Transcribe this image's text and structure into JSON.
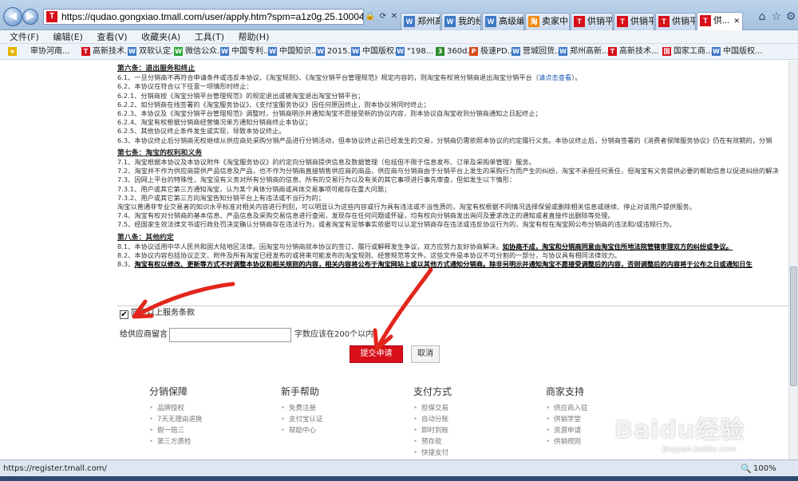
{
  "browser": {
    "url": "https://qudao.gongxiao.tmall.com/user/apply.htm?spm=a1z0g.25.1000440.6.53zmjz&suppli",
    "tabs": [
      {
        "label": "郑州高..."
      },
      {
        "label": "我的经..."
      },
      {
        "label": "高级编..."
      },
      {
        "label": "卖家中..."
      },
      {
        "label": "供销平台"
      },
      {
        "label": "供销平台"
      },
      {
        "label": "供销平台"
      },
      {
        "label": "供..."
      }
    ],
    "menu": [
      "文件(F)",
      "编辑(E)",
      "查看(V)",
      "收藏夹(A)",
      "工具(T)",
      "帮助(H)"
    ],
    "favorites": [
      "审协河南...",
      "高新技术...",
      "双软认定...",
      "微信公众...",
      "中国专利...",
      "中国知识...",
      "2015...",
      "中国版权...",
      "\"198...",
      "360d...",
      "极速PD...",
      "营城回货...",
      "郑州高新...",
      "高新技术...",
      "国家工商...",
      "中国版权..."
    ],
    "status_url": "https://register.tmall.com/",
    "zoom": "100%"
  },
  "agreement": {
    "lines": [
      {
        "text": "第六条：退出服务和终止",
        "style": "h"
      },
      {
        "text": "6.1、一旦分销商不再符合申请条件或违反本协议、《淘宝规则》、《淘宝分销平台管理规范》规定内容的，则淘宝有权将分销商退出淘宝分销平台（",
        "link": "请点击查看",
        "after": "）。"
      },
      {
        "text": "6.2、本协议在符合以下任意一项情形时终止："
      },
      {
        "text": "6.2.1、分销商按《淘宝分销平台管理规范》的规定退出或被淘宝退出淘宝分销平台；"
      },
      {
        "text": "6.2.2、如分销商在线签署的《淘宝服务协议》、《支付宝服务协议》因任何原因终止，则本协议将同时终止；"
      },
      {
        "text": "6.2.3、本协议及《淘宝分销平台管理规范》调整时，分销商明示并通知淘宝不愿接受新的协议内容，则本协议自淘宝收到分销商通知之日起终止；"
      },
      {
        "text": "6.2.4、淘宝有权根据分销商经营情况单方通知分销商终止本协议；"
      },
      {
        "text": "6.2.5、其他协议终止条件发生或实现，导致本协议终止。"
      },
      {
        "text": "6.3、本协议终止后分销商无权继续从供应商处采购分销产品进行分销活动，但本协议终止前已经发生的交易，分销商仍需依照本协议的约定履行义务。本协议终止后，分销商签署的《消费者保障服务协议》仍在有效期的，分销"
      },
      {
        "text": "第七条：淘宝的权利和义务",
        "style": "h"
      },
      {
        "text": "7.1、淘宝根据本协议及本协议附件《淘宝服务协议》的约定向分销商提供信息及数据管理（包括但不限于信息发布、订单及采购单管理）服务。"
      },
      {
        "text": "7.2、淘宝并不作为供应商提供产品信息及产品，也不作为分销商直接销售供应商的商品，供应商与分销商由于分销平台上发生的采购行为而产生的纠纷，淘宝不承担任何责任，但淘宝有义务提供必要的帮助信息以促进纠纷的解决"
      },
      {
        "text": "7.3、因网上平台的特殊性，淘宝没有义务对所有分销商的信息、所有的交易行为以及有关的其它事项进行事先审查，但如发生以下情形："
      },
      {
        "text": "7.3.1、用户或其它第三方通知淘宝，认为某个具体分销商或具体交易事项可能存在重大问题；"
      },
      {
        "text": "7.3.2、用户或其它第三方向淘宝告知分销平台上有违法或不当行为的；"
      },
      {
        "text": "淘宝以普通非专业交易者的知识水平标准对相关内容进行判别，可以明显认为这些内容或行为具有违法或不当性质的，淘宝有权根据不同情况选择保留或删除相关信息或继续、停止对该用户提供服务。"
      },
      {
        "text": "7.4、淘宝有权对分销商的基本信息、产品信息及采购交易信息进行查阅，发现存在任何问题或怀疑，均有权向分销商发出询问及要求改正的通知或者直接作出删除等处理。"
      },
      {
        "text": "7.5、经国家生效法律文书或行政处罚决定确认分销商存在违法行为，或者淘宝有足够事实依据可以认定分销商存在违法或违反协议行为的，淘宝有权在淘宝网公布分销商的违法和/或违规行为。"
      },
      {
        "text": "第八条：其他约定",
        "style": "h"
      },
      {
        "text": "8.1、本协议适用中华人民共和国大陆地区法律。因淘宝与分销商就本协议的签订、履行或解释发生争议，双方应努力友好协商解决。",
        "bold": "如协商不成，淘宝和分销商同意由淘宝住所地法院管辖审理双方的纠纷或争议。"
      },
      {
        "text": "8.2、本协议内容包括协议正文、附件及所有淘宝已经发布的或将来可能发布的淘宝规则、经营规范等文件。这些文件是本协议不可分割的一部分，与协议具有相同法律效力。"
      },
      {
        "text": "8.3、",
        "bold": "淘宝有权以修改、更新等方式不时调整本协议和相关规则的内容，相关内容将公布于淘宝网站上或以其他方式通知分销商。除非另明示并通知淘宝不愿接受调整后的内容，否则调整后的内容将于公布之日或通知日生"
      }
    ]
  },
  "form": {
    "agree_label": "同意以上服务条款",
    "message_label": "给供应商留言：",
    "message_value": "",
    "message_hint": "字数应该在200个以内",
    "submit_label": "提交申请",
    "cancel_label": "取消"
  },
  "footer": {
    "columns": [
      {
        "title": "分销保障",
        "items": [
          "品牌授权",
          "7天无理由退换",
          "假一赔三",
          "第三方质检"
        ]
      },
      {
        "title": "新手帮助",
        "items": [
          "免费注册",
          "支付宝认证",
          "帮助中心"
        ]
      },
      {
        "title": "支付方式",
        "items": [
          "担保交易",
          "自动分账",
          "即时到账",
          "预存款",
          "快捷支付"
        ]
      },
      {
        "title": "商家支持",
        "items": [
          "供应商入驻",
          "供销学堂",
          "资源申请",
          "供销规则"
        ]
      }
    ]
  },
  "watermark": {
    "logo": "Baidu经验",
    "url": "jingyan.baidu.com"
  }
}
